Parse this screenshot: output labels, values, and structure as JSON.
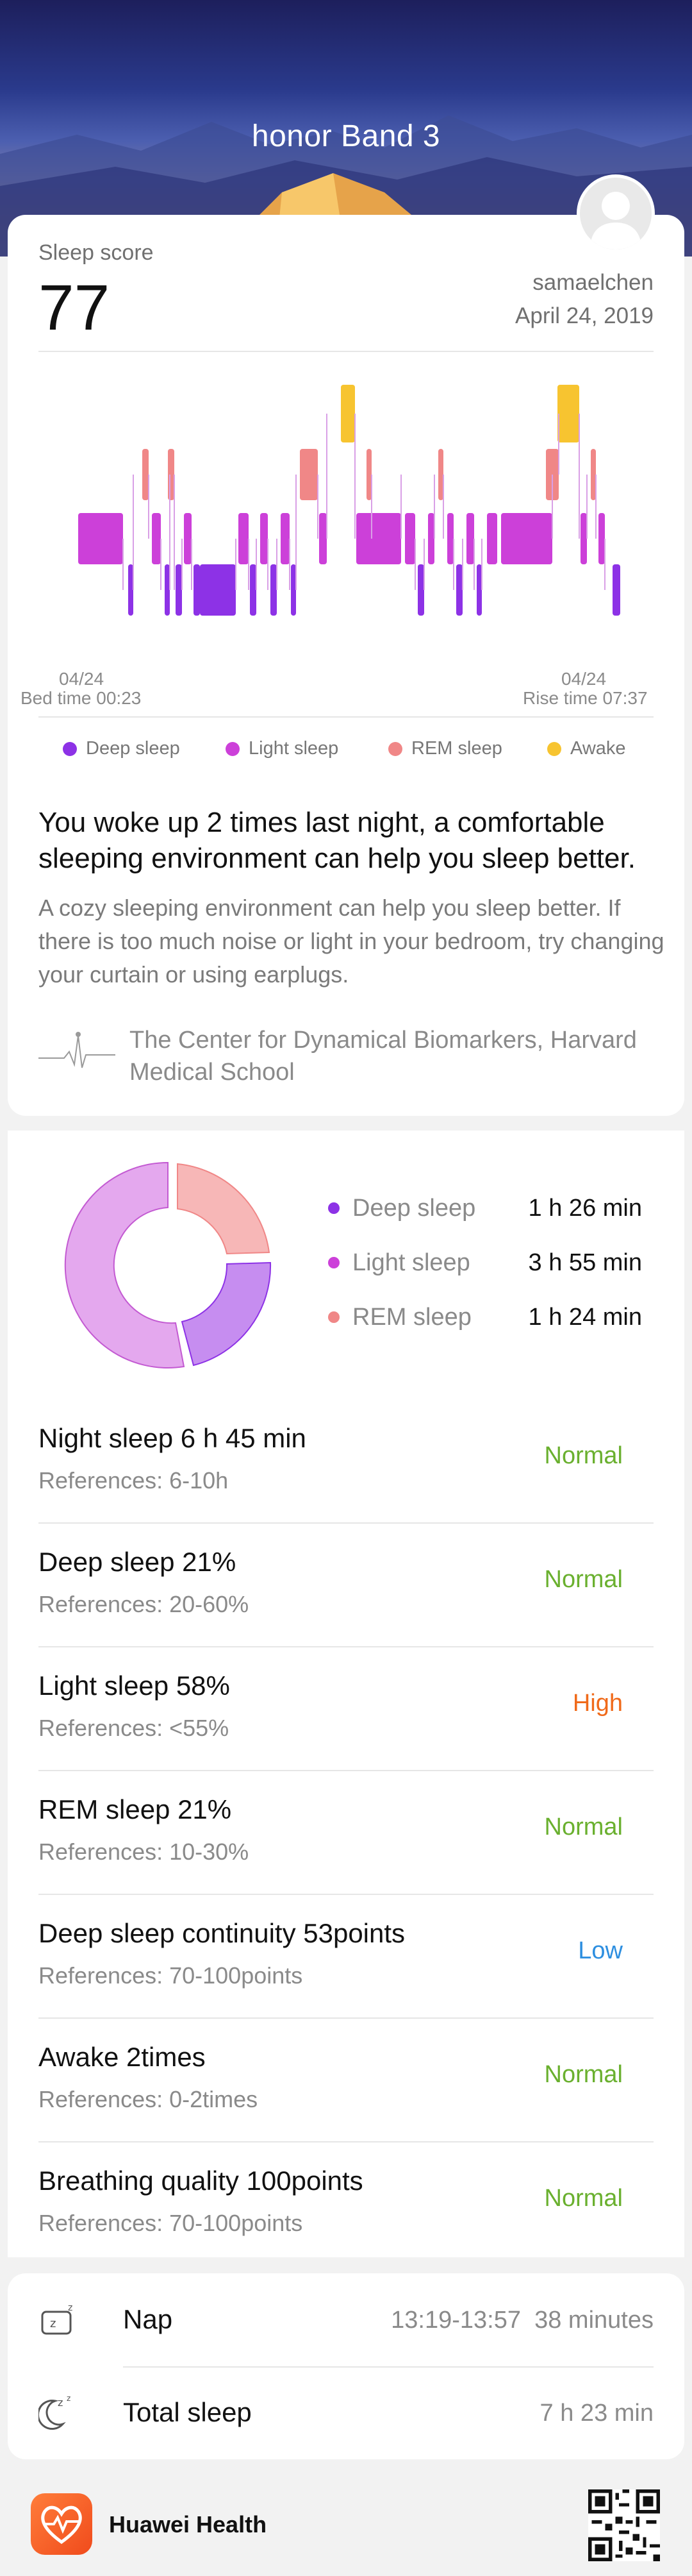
{
  "header": {
    "title": "honor Band 3"
  },
  "score": {
    "label": "Sleep score",
    "value": "77",
    "user": "samaelchen",
    "date": "April 24, 2019"
  },
  "chart_data": {
    "type": "timeline",
    "bed": {
      "date": "04/24",
      "label": "Bed time 00:23"
    },
    "rise": {
      "date": "04/24",
      "label": "Rise time 07:37"
    },
    "legend": [
      {
        "label": "Deep sleep",
        "color": "#8d32e6"
      },
      {
        "label": "Light sleep",
        "color": "#cc40d9"
      },
      {
        "label": "REM sleep",
        "color": "#f08787"
      },
      {
        "label": "Awake",
        "color": "#f7c430"
      }
    ],
    "stages": [
      "Awake",
      "REM sleep",
      "Light sleep",
      "Deep sleep"
    ],
    "start": "00:23",
    "end": "07:37"
  },
  "message": {
    "title": "You woke up 2 times last night, a comfortable sleeping environment can help you sleep better.",
    "body": "A cozy sleeping environment can help you sleep better. If there is too much noise or light in your bedroom, try changing your curtain or using earplugs.",
    "source": "The Center for Dynamical Biomarkers, Harvard Medical School"
  },
  "breakdown": [
    {
      "label": "Deep sleep",
      "value": "1 h 26 min",
      "color": "#8d32e6"
    },
    {
      "label": "Light sleep",
      "value": "3 h 55 min",
      "color": "#cc40d9"
    },
    {
      "label": "REM sleep",
      "value": "1 h 24 min",
      "color": "#f08787"
    }
  ],
  "metrics": [
    {
      "name": "Night sleep  6 h 45 min",
      "ref": "References: 6-10h",
      "status": "Normal",
      "color": "#6ab02f"
    },
    {
      "name": "Deep sleep  21%",
      "ref": "References: 20-60%",
      "status": "Normal",
      "color": "#6ab02f"
    },
    {
      "name": "Light sleep  58%",
      "ref": "References: <55%",
      "status": "High",
      "color": "#f06a1a"
    },
    {
      "name": "REM sleep  21%",
      "ref": "References: 10-30%",
      "status": "Normal",
      "color": "#6ab02f"
    },
    {
      "name": "Deep sleep continuity  53points",
      "ref": "References: 70-100points",
      "status": "Low",
      "color": "#2e8fe0"
    },
    {
      "name": "Awake  2times",
      "ref": "References: 0-2times",
      "status": "Normal",
      "color": "#6ab02f"
    },
    {
      "name": "Breathing quality  100points",
      "ref": "References: 70-100points",
      "status": "Normal",
      "color": "#6ab02f"
    }
  ],
  "nap": {
    "label": "Nap",
    "time": "13:19-13:57",
    "duration": "38 minutes"
  },
  "total": {
    "label": "Total sleep",
    "value": "7 h 23 min"
  },
  "footer": {
    "app_name": "Huawei Health"
  }
}
